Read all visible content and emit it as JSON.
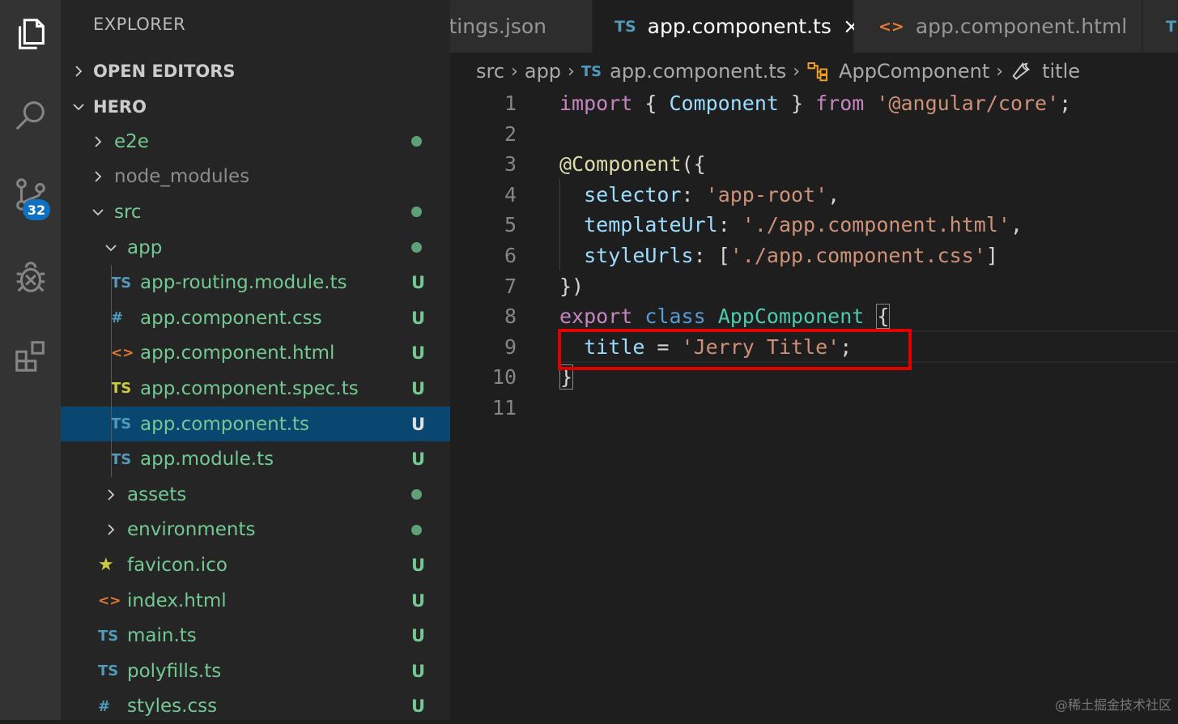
{
  "explorer_title": "EXPLORER",
  "sections": {
    "open_editors": "OPEN EDITORS",
    "project": "HERO"
  },
  "tree": [
    {
      "name": "e2e",
      "kind": "folder",
      "status": "dot"
    },
    {
      "name": "node_modules",
      "kind": "folder",
      "status": ""
    },
    {
      "name": "src",
      "kind": "folder-open",
      "status": "dot"
    },
    {
      "name": "app",
      "kind": "folder-open",
      "status": "dot"
    },
    {
      "name": "app-routing.module.ts",
      "kind": "ts",
      "status": "U"
    },
    {
      "name": "app.component.css",
      "kind": "css",
      "status": "U"
    },
    {
      "name": "app.component.html",
      "kind": "html",
      "status": "U"
    },
    {
      "name": "app.component.spec.ts",
      "kind": "spec",
      "status": "U"
    },
    {
      "name": "app.component.ts",
      "kind": "ts",
      "status": "U",
      "selected": true
    },
    {
      "name": "app.module.ts",
      "kind": "ts",
      "status": "U"
    },
    {
      "name": "assets",
      "kind": "folder",
      "status": "dot"
    },
    {
      "name": "environments",
      "kind": "folder",
      "status": "dot"
    },
    {
      "name": "favicon.ico",
      "kind": "star",
      "status": "U"
    },
    {
      "name": "index.html",
      "kind": "html",
      "status": "U"
    },
    {
      "name": "main.ts",
      "kind": "ts",
      "status": "U"
    },
    {
      "name": "polyfills.ts",
      "kind": "ts",
      "status": "U"
    },
    {
      "name": "styles.css",
      "kind": "css",
      "status": "U"
    }
  ],
  "icon_glyphs": {
    "ts": "TS",
    "spec": "TS",
    "css": "#",
    "html": "<>",
    "star": "★"
  },
  "source_control_badge": "32",
  "tabs": [
    {
      "label": "ttings.json",
      "icon": ""
    },
    {
      "label": "app.component.ts",
      "icon": "TS",
      "active": true,
      "close": "×"
    },
    {
      "label": "app.component.html",
      "icon": "<>"
    },
    {
      "label": "",
      "icon": "T"
    }
  ],
  "breadcrumb": {
    "items": [
      "src",
      "app",
      "app.component.ts",
      "AppComponent",
      "title"
    ],
    "file_icon": "TS",
    "separator": "›"
  },
  "code_lines": [
    [
      [
        "kw",
        "import"
      ],
      [
        "punc",
        " { "
      ],
      [
        "ident",
        "Component"
      ],
      [
        "punc",
        " } "
      ],
      [
        "kw",
        "from"
      ],
      [
        "punc",
        " "
      ],
      [
        "str",
        "'@angular/core'"
      ],
      [
        "punc",
        ";"
      ]
    ],
    [],
    [
      [
        "dec",
        "@Component"
      ],
      [
        "punc",
        "({"
      ]
    ],
    [
      [
        "punc",
        "  "
      ],
      [
        "ident",
        "selector"
      ],
      [
        "punc",
        ": "
      ],
      [
        "str",
        "'app-root'"
      ],
      [
        "punc",
        ","
      ]
    ],
    [
      [
        "punc",
        "  "
      ],
      [
        "ident",
        "templateUrl"
      ],
      [
        "punc",
        ": "
      ],
      [
        "str",
        "'./app.component.html'"
      ],
      [
        "punc",
        ","
      ]
    ],
    [
      [
        "punc",
        "  "
      ],
      [
        "ident",
        "styleUrls"
      ],
      [
        "punc",
        ": ["
      ],
      [
        "str",
        "'./app.component.css'"
      ],
      [
        "punc",
        "]"
      ]
    ],
    [
      [
        "punc",
        "})"
      ]
    ],
    [
      [
        "kw",
        "export"
      ],
      [
        "punc",
        " "
      ],
      [
        "kw2",
        "class"
      ],
      [
        "punc",
        " "
      ],
      [
        "cls",
        "AppComponent"
      ],
      [
        "punc",
        " "
      ],
      [
        "punc",
        "{"
      ]
    ],
    [
      [
        "punc",
        "  "
      ],
      [
        "ident",
        "title"
      ],
      [
        "punc",
        " = "
      ],
      [
        "str",
        "'Jerry Title'"
      ],
      [
        "punc",
        ";"
      ]
    ],
    [
      [
        "punc",
        "}"
      ]
    ],
    []
  ],
  "line_numbers": [
    "1",
    "2",
    "3",
    "4",
    "5",
    "6",
    "7",
    "8",
    "9",
    "10",
    "11"
  ],
  "colors": {
    "accent": "#0e70c0",
    "highlight_box": "#e00000",
    "selected_row": "#094771",
    "git_untracked": "#73c991"
  },
  "watermark": "@稀土掘金技术社区"
}
